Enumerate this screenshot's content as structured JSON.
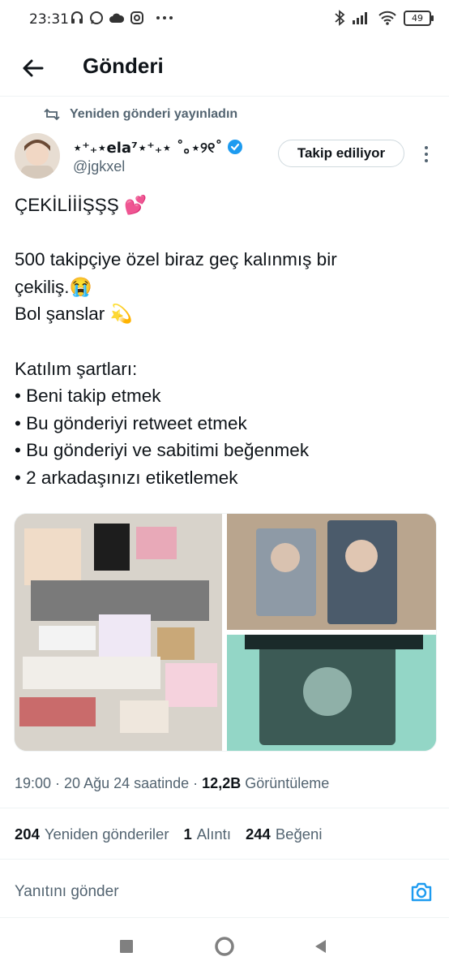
{
  "status_bar": {
    "time": "23:31",
    "icons_left": [
      "headphones-icon",
      "whatsapp-icon",
      "cloud-icon",
      "instagram-icon",
      "more-dots-icon"
    ],
    "icons_right": [
      "bluetooth-icon",
      "signal-icon",
      "wifi-icon"
    ],
    "battery": "49"
  },
  "header": {
    "title": "Gönderi"
  },
  "post": {
    "repost_label": "Yeniden gönderi yayınladın",
    "author_name": "⋆⁺₊⋆ela⁷⋆⁺₊⋆ ˚｡⋆୨୧˚",
    "handle": "@jgkxel",
    "follow_label": "Takip ediliyor",
    "lines": [
      "ÇEKİLİİİŞŞŞ 💕",
      "",
      "500 takipçiye özel biraz geç kalınmış bir",
      "çekiliş.😭",
      "Bol şanslar 💫",
      "",
      "Katılım şartları:",
      "• Beni takip etmek",
      "• Bu gönderiyi retweet etmek",
      "• Bu gönderiyi ve sabitimi beğenmek",
      "• 2 arkadaşınızı etiketlemek"
    ],
    "timestamp": "19:00 · 20 Ağu 24 saatinde · ",
    "views_count": "12,2B",
    "views_label": " Görüntüleme",
    "stats": [
      {
        "num": "204",
        "label": "Yeniden gönderiler"
      },
      {
        "num": "1",
        "label": "Alıntı"
      },
      {
        "num": "244",
        "label": "Beğeni"
      }
    ]
  },
  "reply": {
    "placeholder": "Yanıtını gönder"
  },
  "colors": {
    "accent": "#1d9bf0",
    "text": "#0f1419",
    "muted": "#536471",
    "border": "#eff3f4"
  }
}
